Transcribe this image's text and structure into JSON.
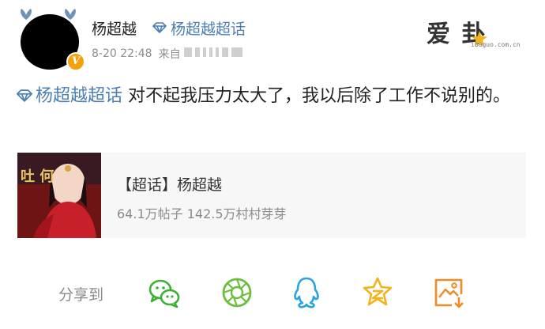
{
  "post": {
    "username": "杨超越",
    "topic_link": "杨超越超话",
    "timestamp": "8-20 22:48",
    "source_prefix": "来自",
    "topic_tag": "杨超越超话",
    "text": " 对不起我压力太大了，我以后除了工作不说别的。"
  },
  "watermark": {
    "brand": "爱 卦",
    "url": "ibaguo.com.cn"
  },
  "card": {
    "title": "【超话】杨超越",
    "stats": "64.1万帖子 142.5万村村芽芽",
    "poster_text": "吐 何"
  },
  "share": {
    "label": "分享到",
    "targets": [
      "wechat-icon",
      "moments-icon",
      "qq-icon",
      "qzone-icon",
      "save-image-icon"
    ]
  },
  "colors": {
    "link": "#4d7fb4",
    "wechat": "#3cb034",
    "moments": "#6bbf3c",
    "qq": "#2aa3e0",
    "qzone": "#f2b31b",
    "save": "#f08a24",
    "verified": "#f2a30b"
  }
}
